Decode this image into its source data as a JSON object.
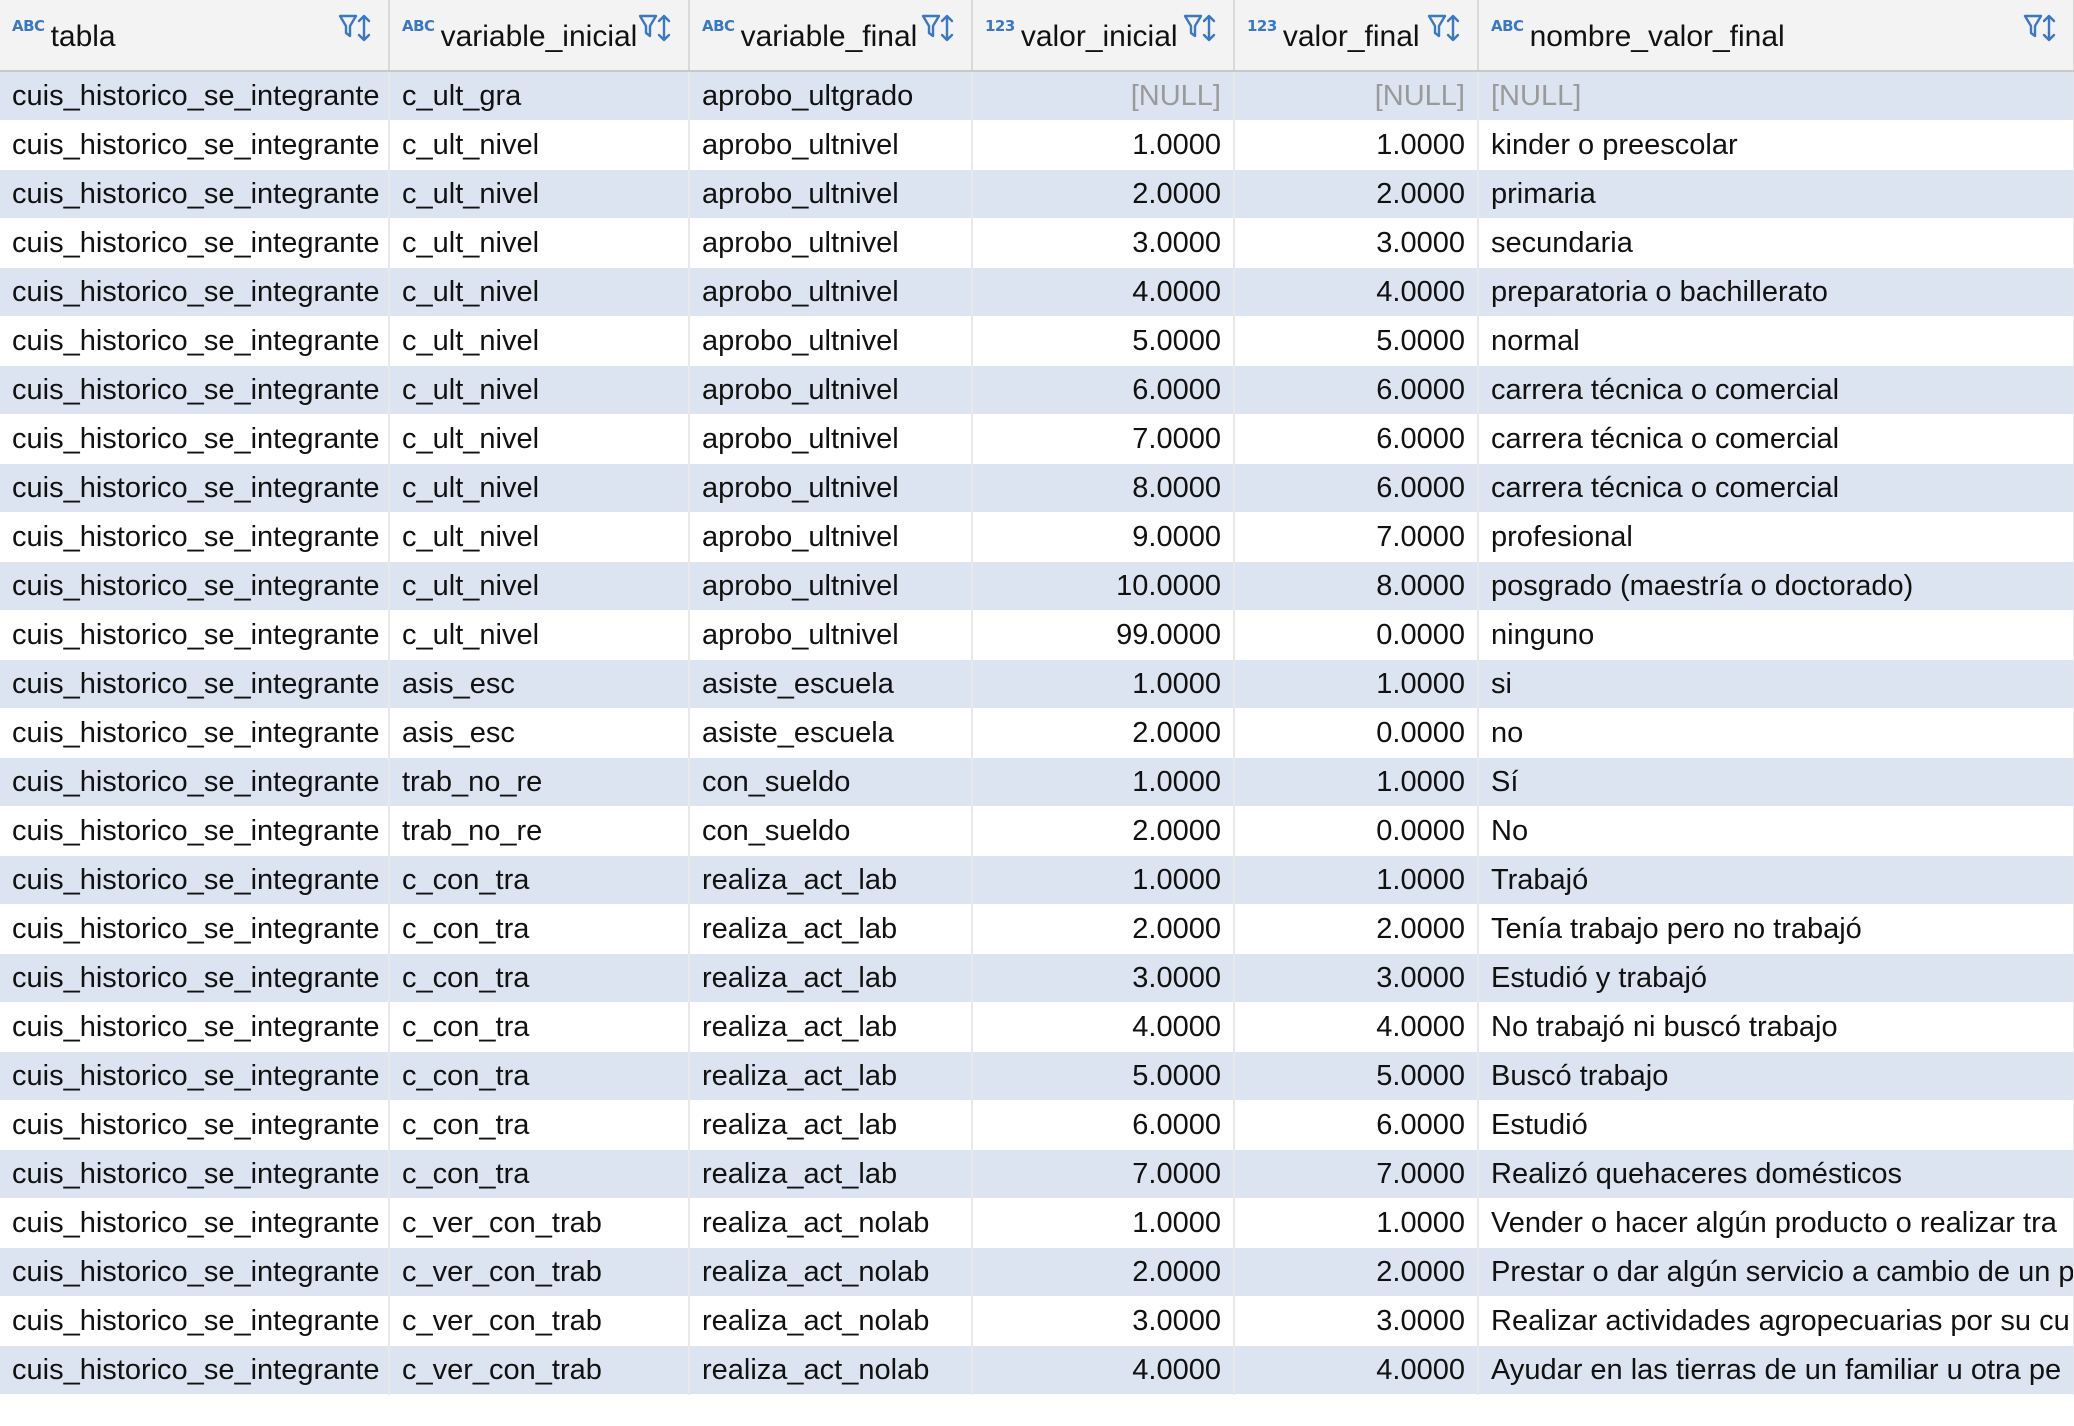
{
  "columns": [
    {
      "type": "ABC",
      "name": "tabla"
    },
    {
      "type": "ABC",
      "name": "variable_inicial"
    },
    {
      "type": "ABC",
      "name": "variable_final"
    },
    {
      "type": "123",
      "name": "valor_inicial"
    },
    {
      "type": "123",
      "name": "valor_final"
    },
    {
      "type": "ABC",
      "name": "nombre_valor_final"
    }
  ],
  "rows": [
    [
      "cuis_historico_se_integrante",
      "c_ult_gra",
      "aprobo_ultgrado",
      "[NULL]",
      "[NULL]",
      "[NULL]"
    ],
    [
      "cuis_historico_se_integrante",
      "c_ult_nivel",
      "aprobo_ultnivel",
      "1.0000",
      "1.0000",
      "kinder o preescolar"
    ],
    [
      "cuis_historico_se_integrante",
      "c_ult_nivel",
      "aprobo_ultnivel",
      "2.0000",
      "2.0000",
      "primaria"
    ],
    [
      "cuis_historico_se_integrante",
      "c_ult_nivel",
      "aprobo_ultnivel",
      "3.0000",
      "3.0000",
      "secundaria"
    ],
    [
      "cuis_historico_se_integrante",
      "c_ult_nivel",
      "aprobo_ultnivel",
      "4.0000",
      "4.0000",
      "preparatoria o bachillerato"
    ],
    [
      "cuis_historico_se_integrante",
      "c_ult_nivel",
      "aprobo_ultnivel",
      "5.0000",
      "5.0000",
      "normal"
    ],
    [
      "cuis_historico_se_integrante",
      "c_ult_nivel",
      "aprobo_ultnivel",
      "6.0000",
      "6.0000",
      "carrera técnica o comercial"
    ],
    [
      "cuis_historico_se_integrante",
      "c_ult_nivel",
      "aprobo_ultnivel",
      "7.0000",
      "6.0000",
      "carrera técnica o comercial"
    ],
    [
      "cuis_historico_se_integrante",
      "c_ult_nivel",
      "aprobo_ultnivel",
      "8.0000",
      "6.0000",
      "carrera técnica o comercial"
    ],
    [
      "cuis_historico_se_integrante",
      "c_ult_nivel",
      "aprobo_ultnivel",
      "9.0000",
      "7.0000",
      "profesional"
    ],
    [
      "cuis_historico_se_integrante",
      "c_ult_nivel",
      "aprobo_ultnivel",
      "10.0000",
      "8.0000",
      "posgrado (maestría o doctorado)"
    ],
    [
      "cuis_historico_se_integrante",
      "c_ult_nivel",
      "aprobo_ultnivel",
      "99.0000",
      "0.0000",
      "ninguno"
    ],
    [
      "cuis_historico_se_integrante",
      "asis_esc",
      "asiste_escuela",
      "1.0000",
      "1.0000",
      "si"
    ],
    [
      "cuis_historico_se_integrante",
      "asis_esc",
      "asiste_escuela",
      "2.0000",
      "0.0000",
      "no"
    ],
    [
      "cuis_historico_se_integrante",
      "trab_no_re",
      "con_sueldo",
      "1.0000",
      "1.0000",
      "Sí"
    ],
    [
      "cuis_historico_se_integrante",
      "trab_no_re",
      "con_sueldo",
      "2.0000",
      "0.0000",
      "No"
    ],
    [
      "cuis_historico_se_integrante",
      "c_con_tra",
      "realiza_act_lab",
      "1.0000",
      "1.0000",
      "Trabajó"
    ],
    [
      "cuis_historico_se_integrante",
      "c_con_tra",
      "realiza_act_lab",
      "2.0000",
      "2.0000",
      "Tenía trabajo pero no trabajó"
    ],
    [
      "cuis_historico_se_integrante",
      "c_con_tra",
      "realiza_act_lab",
      "3.0000",
      "3.0000",
      "Estudió y trabajó"
    ],
    [
      "cuis_historico_se_integrante",
      "c_con_tra",
      "realiza_act_lab",
      "4.0000",
      "4.0000",
      "No trabajó ni buscó trabajo"
    ],
    [
      "cuis_historico_se_integrante",
      "c_con_tra",
      "realiza_act_lab",
      "5.0000",
      "5.0000",
      "Buscó trabajo"
    ],
    [
      "cuis_historico_se_integrante",
      "c_con_tra",
      "realiza_act_lab",
      "6.0000",
      "6.0000",
      "Estudió"
    ],
    [
      "cuis_historico_se_integrante",
      "c_con_tra",
      "realiza_act_lab",
      "7.0000",
      "7.0000",
      "Realizó quehaceres domésticos"
    ],
    [
      "cuis_historico_se_integrante",
      "c_ver_con_trab",
      "realiza_act_nolab",
      "1.0000",
      "1.0000",
      "Vender o hacer algún producto o realizar tra"
    ],
    [
      "cuis_historico_se_integrante",
      "c_ver_con_trab",
      "realiza_act_nolab",
      "2.0000",
      "2.0000",
      "Prestar o dar algún servicio a cambio de un p"
    ],
    [
      "cuis_historico_se_integrante",
      "c_ver_con_trab",
      "realiza_act_nolab",
      "3.0000",
      "3.0000",
      "Realizar actividades agropecuarias por su cu"
    ],
    [
      "cuis_historico_se_integrante",
      "c_ver_con_trab",
      "realiza_act_nolab",
      "4.0000",
      "4.0000",
      "Ayudar en las tierras de un familiar u otra pe"
    ]
  ],
  "colors": {
    "type_icon": "#3a78c3",
    "row_alt": "#dbe4f0",
    "null_text": "#9a9a9a"
  }
}
